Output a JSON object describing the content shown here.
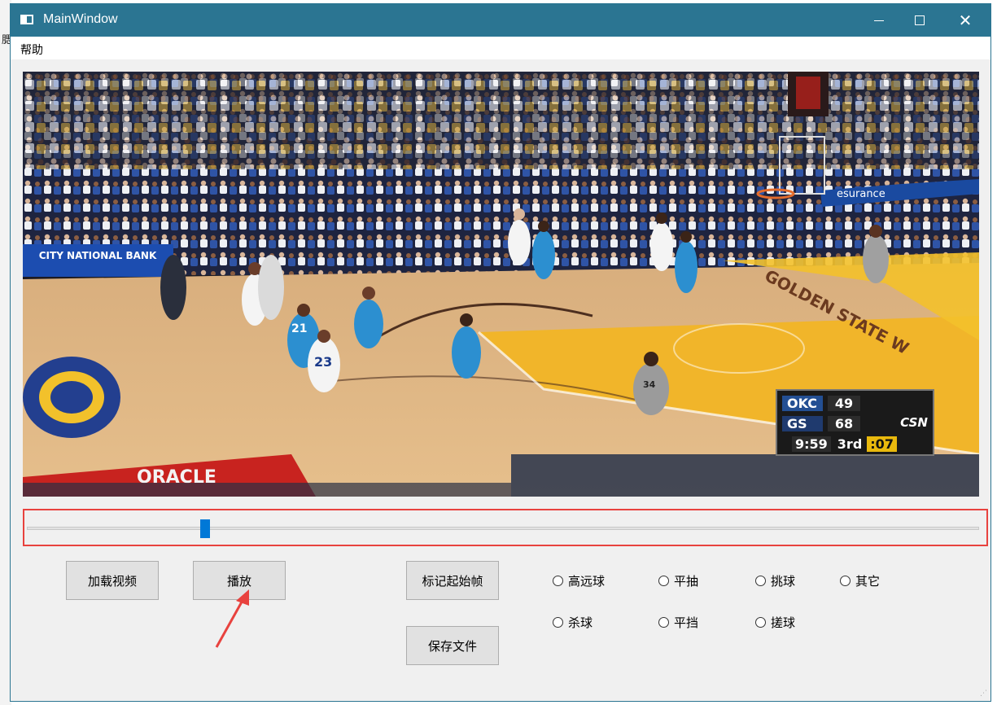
{
  "background": {
    "left_glyph": "腮"
  },
  "window": {
    "title": "MainWindow",
    "titlebar_color": "#2b7592",
    "close_glyph": "✕"
  },
  "menu": {
    "items": [
      "帮助"
    ]
  },
  "video": {
    "scoreboard": {
      "team1": "OKC",
      "score1": "49",
      "team2": "GS",
      "score2": "68",
      "network": "CSN",
      "clock": "9:59",
      "period": "3rd",
      "shot_clock": ":07"
    },
    "signs": {
      "city_national": "CITY NATIONAL BANK",
      "esurance": "esurance",
      "oracle": "ORACLE",
      "baseline": "GOLDEN STATE W"
    },
    "jersey_numbers": [
      "21",
      "23",
      "34"
    ]
  },
  "slider": {
    "position_fraction": 0.187,
    "highlight_color": "#e8423e",
    "handle_color": "#0078d7"
  },
  "buttons": {
    "load_video": "加载视频",
    "play": "播放",
    "mark_start": "标记起始帧",
    "save_file": "保存文件"
  },
  "radios": {
    "row1": [
      "高远球",
      "平抽",
      "挑球",
      "其它"
    ],
    "row2": [
      "杀球",
      "平挡",
      "搓球"
    ]
  },
  "annotation": {
    "arrow_color": "#e8423e"
  }
}
